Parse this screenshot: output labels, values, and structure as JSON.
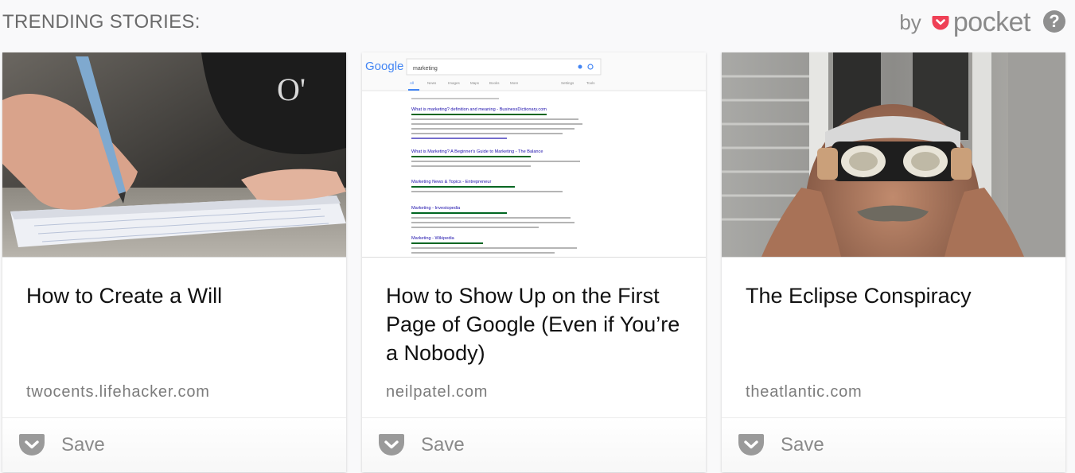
{
  "header": {
    "section_title": "TRENDING STORIES:",
    "by_label": "by",
    "brand_name": "pocket",
    "help_glyph": "?"
  },
  "cards": [
    {
      "title": "How to Create a Will",
      "domain": "twocents.lifehacker.com",
      "save_label": "Save",
      "thumbnail_icon": "hand-writing-in-notebook-image"
    },
    {
      "title": "How to Show Up on the First Page of Google (Even if You’re a Nobody)",
      "domain": "neilpatel.com",
      "save_label": "Save",
      "thumbnail_icon": "google-search-results-image",
      "thumbnail": {
        "logo_text": "Google",
        "query_text": "marketing",
        "result_titles": [
          "What is marketing? definition and meaning - BusinessDictionary.com",
          "What is Marketing? A Beginner's Guide to Marketing - The Balance",
          "Marketing News & Topics - Entrepreneur",
          "Marketing - Investopedia",
          "Marketing - Wikipedia"
        ]
      }
    },
    {
      "title": "The Eclipse Conspiracy",
      "domain": "theatlantic.com",
      "save_label": "Save",
      "thumbnail_icon": "man-with-eclipse-glasses-image"
    }
  ],
  "colors": {
    "pocket_red": "#ef4056",
    "text_primary": "#111111",
    "text_muted": "#7c7c7c",
    "icon_gray": "#8f8f8f"
  }
}
